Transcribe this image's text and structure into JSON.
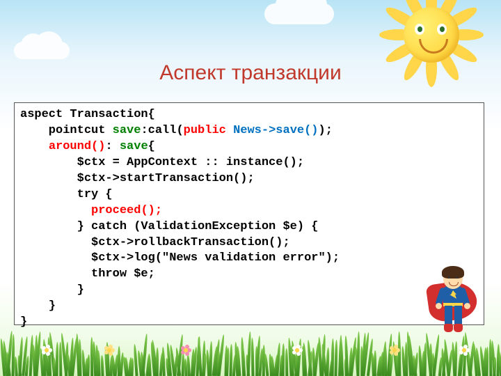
{
  "title": "Аспект транзакции",
  "code": {
    "l1a": "aspect Transaction{",
    "l2a": "    pointcut ",
    "l2b": "save",
    "l2c": ":call(",
    "l2d": "public",
    "l2e": " ",
    "l2f": "News->save()",
    "l2g": ");",
    "l3a": "    ",
    "l3b": "around()",
    "l3c": ": ",
    "l3d": "save",
    "l3e": "{",
    "l4": "        $ctx = AppContext :: instance();",
    "l5": "        $ctx->startTransaction();",
    "l6": "        try {",
    "l7a": "          ",
    "l7b": "proceed();",
    "l8": "        } catch (ValidationException $e) {",
    "l9": "          $ctx->rollbackTransaction();",
    "l10": "          $ctx->log(\"News validation error\");",
    "l11": "          throw $e;",
    "l12": "        }",
    "l13": "    }",
    "l14": "}"
  }
}
